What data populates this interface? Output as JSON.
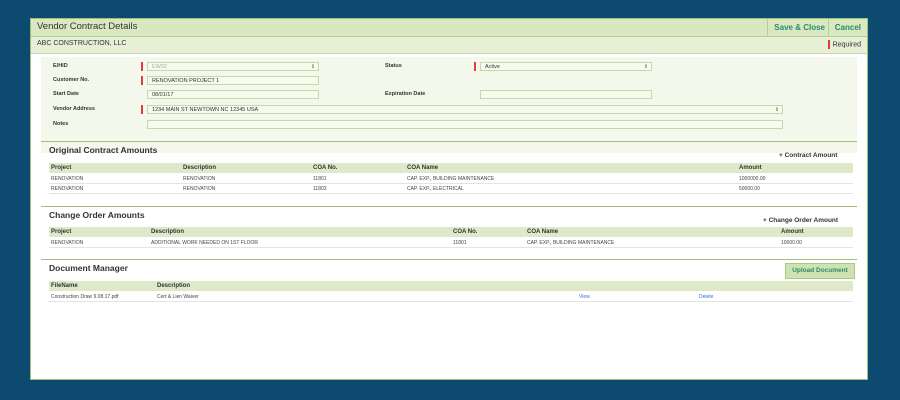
{
  "window": {
    "title": "Vendor Contract Details",
    "save_label": "Save & Close",
    "cancel_label": "Cancel",
    "company": "ABC CONSTRUCTION, LLC",
    "required_label": "Required"
  },
  "form": {
    "ehid_label": "E/HID",
    "ehid_value": "EW02",
    "customer_label": "Customer No.",
    "customer_value": "RENOVATION PROJECT 1",
    "start_label": "Start Date",
    "start_value": "08/01/17",
    "status_label": "Status",
    "status_value": "Active",
    "expiration_label": "Expiration Date",
    "expiration_value": "",
    "address_label": "Vendor Address",
    "address_value": "1234 MAIN ST NEWTOWN NC 12345 USA",
    "notes_label": "Notes",
    "notes_value": ""
  },
  "original": {
    "title": "Original Contract Amounts",
    "add_label": "+ Contract Amount",
    "headers": [
      "Project",
      "Description",
      "COA No.",
      "COA Name",
      "Amount"
    ],
    "rows": [
      [
        "RENOVATION",
        "RENOVATION",
        "11801",
        "CAP. EXP., BUILDING MAINTENANCE",
        "1000000.00"
      ],
      [
        "RENOVATION",
        "RENOVATION",
        "11803",
        "CAP. EXP., ELECTRICAL",
        "50000.00"
      ]
    ]
  },
  "change": {
    "title": "Change Order Amounts",
    "add_label": "+ Change Order Amount",
    "headers": [
      "Project",
      "Description",
      "COA No.",
      "COA Name",
      "Amount"
    ],
    "rows": [
      [
        "RENOVATION",
        "ADDITIONAL WORK NEEDED ON 1ST FLOOR",
        "11801",
        "CAP. EXP., BUILDING MAINTENANCE",
        "10000.00"
      ]
    ]
  },
  "documents": {
    "title": "Document Manager",
    "upload_label": "Upload Document",
    "headers": [
      "FileName",
      "Description"
    ],
    "rows": [
      {
        "file": "Construction Draw 9.08.17.pdf",
        "description": "Cert & Lien Waiver",
        "view": "View",
        "delete": "Delete"
      }
    ]
  },
  "colors": {
    "background": "#0d4a70",
    "accent": "#2a8a6e",
    "required_mark": "#e23b3b",
    "header_green": "#dde9c8"
  }
}
